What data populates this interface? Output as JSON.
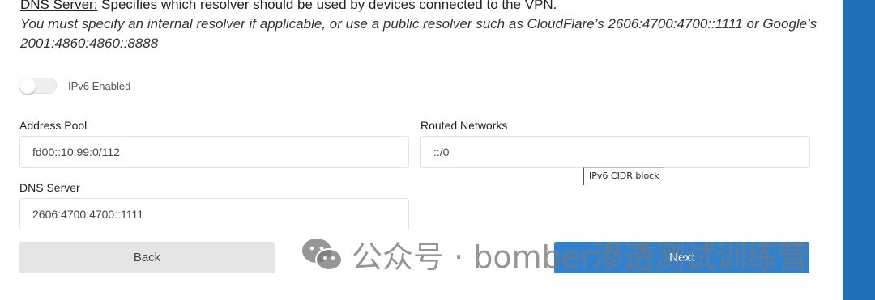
{
  "help": {
    "term": "DNS Server:",
    "description": " Specifies which resolver should be used by devices connected to the VPN.",
    "note": "You must specify an internal resolver if applicable, or use a public resolver such as CloudFlare’s 2606:4700:4700::1111 or Google’s 2001:4860:4860::8888"
  },
  "ipv6": {
    "label": "IPv6 Enabled",
    "enabled": false
  },
  "fields": {
    "address_pool": {
      "label": "Address Pool",
      "value": "fd00::10:99:0/112"
    },
    "routed_networks": {
      "label": "Routed Networks",
      "value": "::/0"
    },
    "dns_server": {
      "label": "DNS Server",
      "value": "2606:4700:4700::1111"
    }
  },
  "tooltip": {
    "text": "IPv6 CIDR block"
  },
  "buttons": {
    "back": "Back",
    "next": "Next"
  },
  "watermark": {
    "text": "公众号 · bomber渗透测试训练营"
  },
  "colors": {
    "accent": "#2e82cf",
    "sidebar": "#1e6fb6",
    "back_button": "#e5e5e5"
  }
}
